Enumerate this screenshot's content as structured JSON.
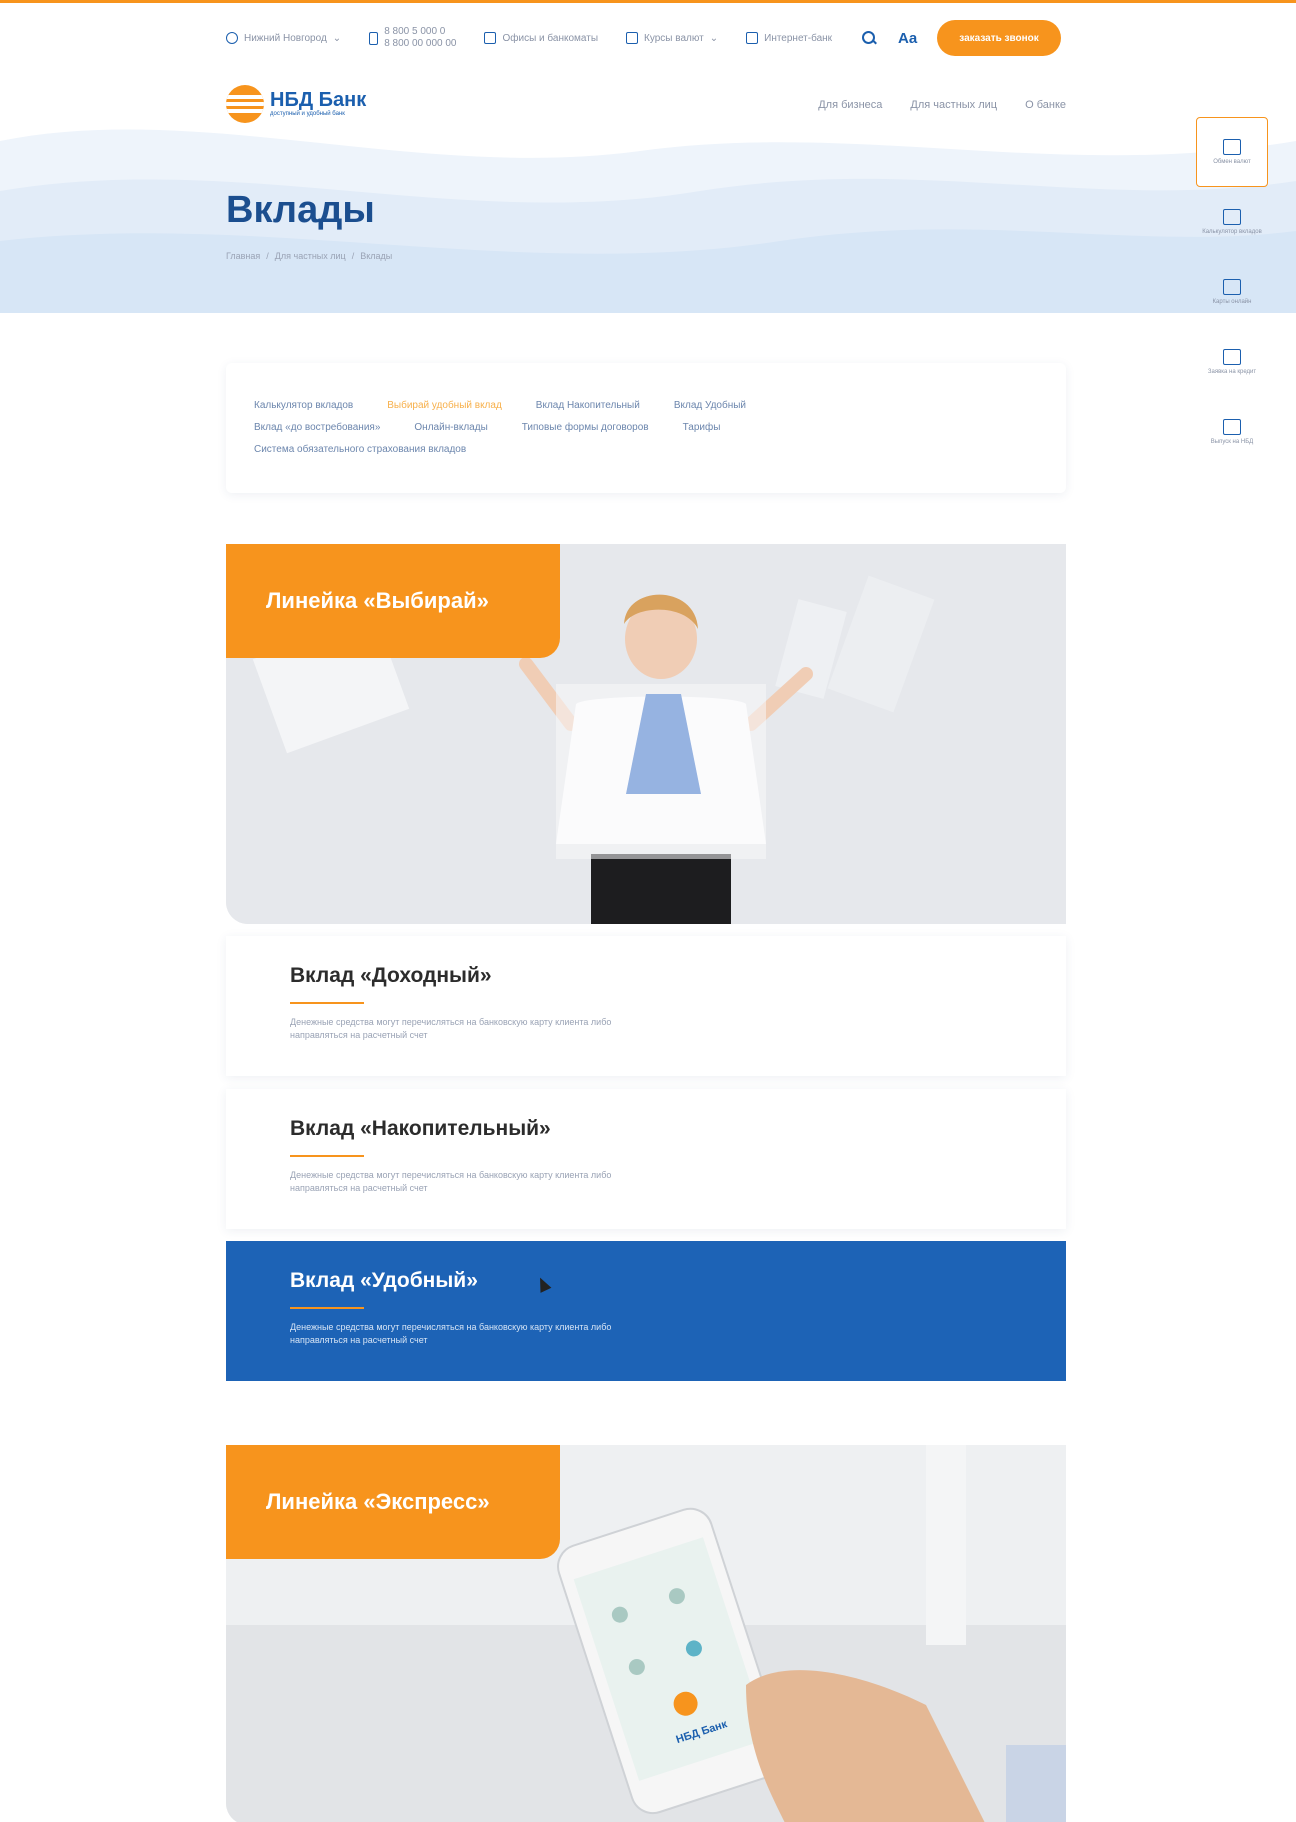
{
  "topbar": {
    "city": "Нижний Новгород",
    "phone_1": "8 800 5 000 0",
    "phone_2": "8 800 00 000 00",
    "offices": "Офисы и банкоматы",
    "services": "Курсы валют",
    "calendar": "Интернет-банк",
    "font_size": "Aa",
    "callback_button": "заказать звонок"
  },
  "header": {
    "logo_name": "НБД Банк",
    "logo_sub": "доступный и удобный банк",
    "nav": [
      "Для бизнеса",
      "Для частных лиц",
      "О банке"
    ]
  },
  "hero": {
    "title": "Вклады",
    "breadcrumb": [
      "Главная",
      "/",
      "Для частных лиц",
      "/",
      "Вклады"
    ]
  },
  "widget": [
    {
      "label": "Обмен валют",
      "icon": "exchange-icon"
    },
    {
      "label": "Калькулятор вкладов",
      "icon": "calculator-icon"
    },
    {
      "label": "Карты онлайн",
      "icon": "card-icon"
    },
    {
      "label": "Заявка на кредит",
      "icon": "form-icon"
    },
    {
      "label": "Выпуск на НБД",
      "icon": "monitor-icon"
    }
  ],
  "tags": {
    "row1": [
      "Калькулятор вкладов",
      "Выбирай удобный вклад",
      "Вклад Накопительный",
      "Вклад Удобный"
    ],
    "row2": [
      "Вклад «до востребования»",
      "Онлайн-вклады",
      "Типовые формы договоров",
      "Тарифы"
    ],
    "row3": [
      "Система обязательного страхования вкладов"
    ]
  },
  "products": {
    "line1_label": "Линейка «Выбирай»",
    "card1_title": "Вклад «Доходный»",
    "card1_text": "Денежные средства могут перечисляться на банковскую карту клиента либо направляться на расчетный счет",
    "card2_title": "Вклад «Накопительный»",
    "card2_text": "Денежные средства могут перечисляться на банковскую карту клиента либо направляться на расчетный счет",
    "card3_title": "Вклад «Удобный»",
    "card3_text": "Денежные средства могут перечисляться на банковскую карту клиента либо направляться на расчетный счет",
    "line2_label": "Линейка «Экспресс»",
    "phone_logo": "НБД Банк"
  },
  "colors": {
    "accent": "#f7941d",
    "brand": "#1d63b6",
    "title": "#1b4e8f"
  }
}
